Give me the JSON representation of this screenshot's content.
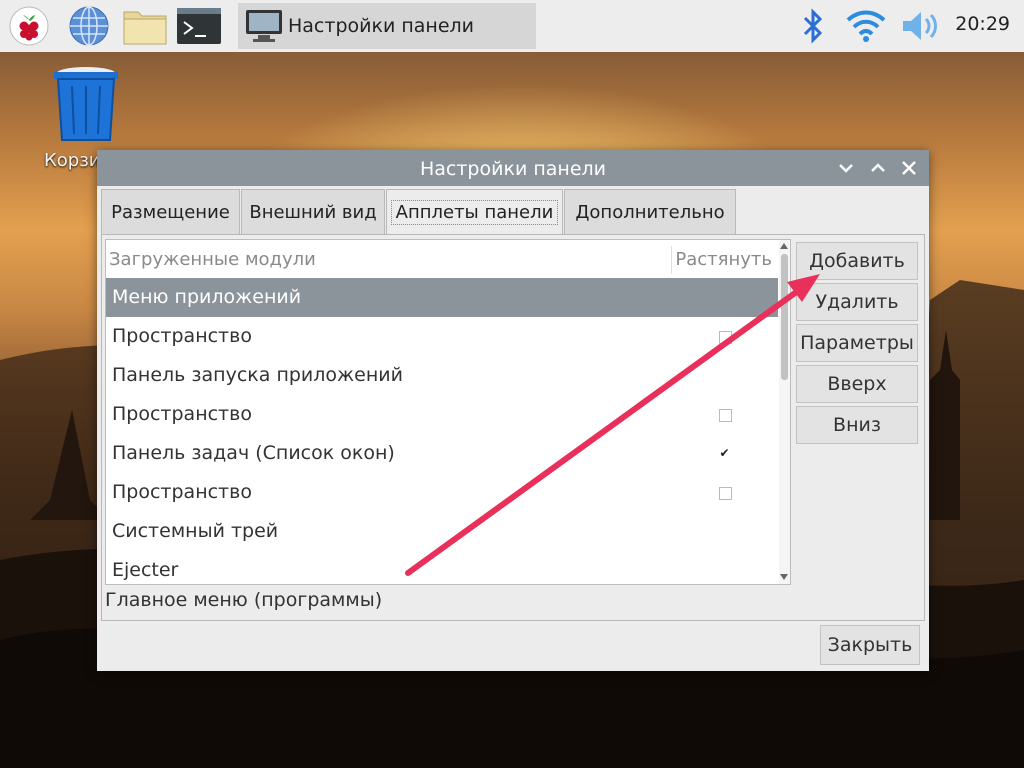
{
  "taskbar": {
    "task_label": "Настройки панели",
    "clock": "20:29",
    "icons": [
      "raspberry-menu-icon",
      "web-browser-icon",
      "file-manager-icon",
      "terminal-icon",
      "bluetooth-icon",
      "wifi-icon",
      "volume-icon"
    ]
  },
  "desktop": {
    "trash_label": "Корзина"
  },
  "dialog": {
    "title": "Настройки панели",
    "tabs": [
      "Размещение",
      "Внешний вид",
      "Апплеты панели",
      "Дополнительно"
    ],
    "list": {
      "headers": {
        "modules": "Загруженные модули",
        "stretch": "Растянуть"
      },
      "rows": [
        {
          "name": "Меню приложений",
          "stretch": null,
          "selected": true
        },
        {
          "name": "Пространство",
          "stretch": false
        },
        {
          "name": "Панель запуска приложений",
          "stretch": null
        },
        {
          "name": "Пространство",
          "stretch": false
        },
        {
          "name": "Панель задач (Список окон)",
          "stretch": true
        },
        {
          "name": "Пространство",
          "stretch": false
        },
        {
          "name": "Системный трей",
          "stretch": null
        },
        {
          "name": "Ejecter",
          "stretch": null
        }
      ]
    },
    "status_text": "Главное меню (программы)",
    "buttons": {
      "add": "Добавить",
      "remove": "Удалить",
      "params": "Параметры",
      "up": "Вверх",
      "down": "Вниз",
      "close": "Закрыть"
    }
  },
  "colors": {
    "selection": "#8b949b",
    "annotation_arrow": "#e8305a"
  }
}
